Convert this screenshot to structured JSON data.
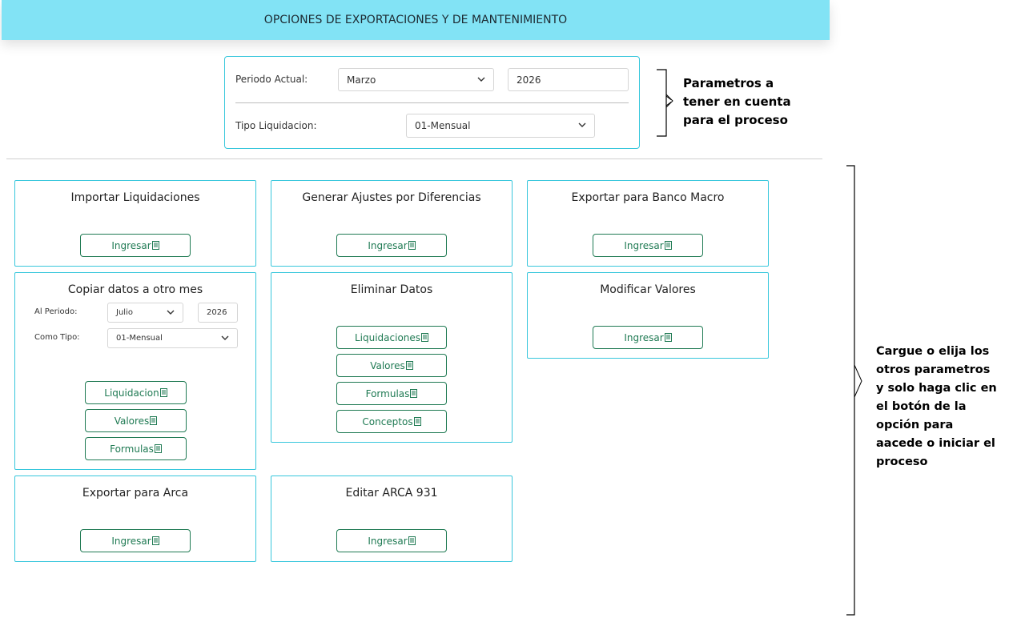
{
  "header": {
    "title": "OPCIONES DE EXPORTACIONES Y DE MANTENIMIENTO"
  },
  "params": {
    "periodo_label": "Periodo Actual:",
    "mes_value": "Marzo",
    "anio_value": "2026",
    "tipo_label": "Tipo Liquidacion:",
    "tipo_value": "01-Mensual"
  },
  "cards": {
    "importar": {
      "title": "Importar Liquidaciones",
      "button": "Ingresar"
    },
    "ajustes": {
      "title": "Generar Ajustes por Diferencias",
      "button": "Ingresar"
    },
    "macro": {
      "title": "Exportar para Banco Macro",
      "button": "Ingresar"
    },
    "copiar": {
      "title": "Copiar datos a otro mes",
      "periodo_label": "Al Periodo:",
      "mes_value": "Julio",
      "anio_value": "2026",
      "tipo_label": "Como Tipo:",
      "tipo_value": "01-Mensual",
      "buttons": [
        "Liquidacion",
        "Valores",
        "Formulas"
      ]
    },
    "eliminar": {
      "title": "Eliminar Datos",
      "buttons": [
        "Liquidaciones",
        "Valores",
        "Formulas",
        "Conceptos"
      ]
    },
    "modificar": {
      "title": "Modificar Valores",
      "button": "Ingresar"
    },
    "arca": {
      "title": "Exportar para Arca",
      "button": "Ingresar"
    },
    "arca931": {
      "title": "Editar ARCA 931",
      "button": "Ingresar"
    }
  },
  "annotations": {
    "top": [
      "Parametros  a",
      "tener en cuenta",
      "para el proceso"
    ],
    "side": [
      "Cargue o elija los",
      "otros parametros",
      "y solo haga clic en",
      "el botón de la",
      "opción para",
      "aacede o iniciar el",
      "proceso"
    ]
  },
  "icons": {
    "button_icon": "document-icon",
    "dropdown_icon": "chevron-down-icon"
  },
  "colors": {
    "header_bg": "#82e3f5",
    "card_border": "#38c7dc",
    "button": "#1f7a53"
  }
}
